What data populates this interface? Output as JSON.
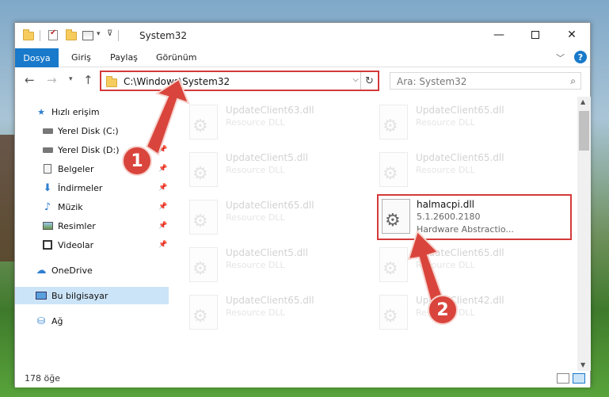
{
  "window": {
    "title": "System32"
  },
  "ribbon": {
    "tabs": [
      "Dosya",
      "Giriş",
      "Paylaş",
      "Görünüm"
    ]
  },
  "address": {
    "path": "C:\\Windows\\System32",
    "search_placeholder": "Ara: System32"
  },
  "sidebar": {
    "items": [
      {
        "label": "Hızlı erişim",
        "icon": "star-icon"
      },
      {
        "label": "Yerel Disk (C:)",
        "icon": "drive-icon",
        "pinned": true
      },
      {
        "label": "Yerel Disk (D:)",
        "icon": "drive-icon",
        "pinned": true
      },
      {
        "label": "Belgeler",
        "icon": "documents-icon",
        "pinned": true
      },
      {
        "label": "İndirmeler",
        "icon": "download-icon",
        "pinned": true
      },
      {
        "label": "Müzik",
        "icon": "music-icon",
        "pinned": true
      },
      {
        "label": "Resimler",
        "icon": "pictures-icon",
        "pinned": true
      },
      {
        "label": "Videolar",
        "icon": "video-icon",
        "pinned": true
      },
      {
        "label": "OneDrive",
        "icon": "cloud-icon"
      },
      {
        "label": "Bu bilgisayar",
        "icon": "computer-icon",
        "selected": true
      },
      {
        "label": "Ağ",
        "icon": "network-icon"
      }
    ]
  },
  "files": [
    {
      "name": "UpdateClient63.dll",
      "type": "Resource DLL"
    },
    {
      "name": "UpdateClient65.dll",
      "type": "Resource DLL"
    },
    {
      "name": "UpdateClient5.dll",
      "type": "Resource DLL"
    },
    {
      "name": "UpdateClient65.dll",
      "type": "Resource DLL"
    },
    {
      "name": "UpdateClient65.dll",
      "type": "Resource DLL"
    },
    {
      "name": "UpdateClient5.dll",
      "type": "Resource DLL"
    },
    {
      "name": "UpdateClient65.dll",
      "type": "Resource DLL"
    },
    {
      "name": "UpdateClient65.dll",
      "type": "Resource DLL"
    },
    {
      "name": "UpdateClient42.dll",
      "type": "Resource DLL"
    }
  ],
  "highlighted_file": {
    "name": "halmacpi.dll",
    "version": "5.1.2600.2180",
    "description": "Hardware Abstractio..."
  },
  "status": {
    "count": "178 öğe"
  },
  "annotations": {
    "step1": "1",
    "step2": "2"
  },
  "colors": {
    "accent": "#1979ca",
    "annotation_red": "#d9453c",
    "highlight_border": "#d33a3a"
  }
}
